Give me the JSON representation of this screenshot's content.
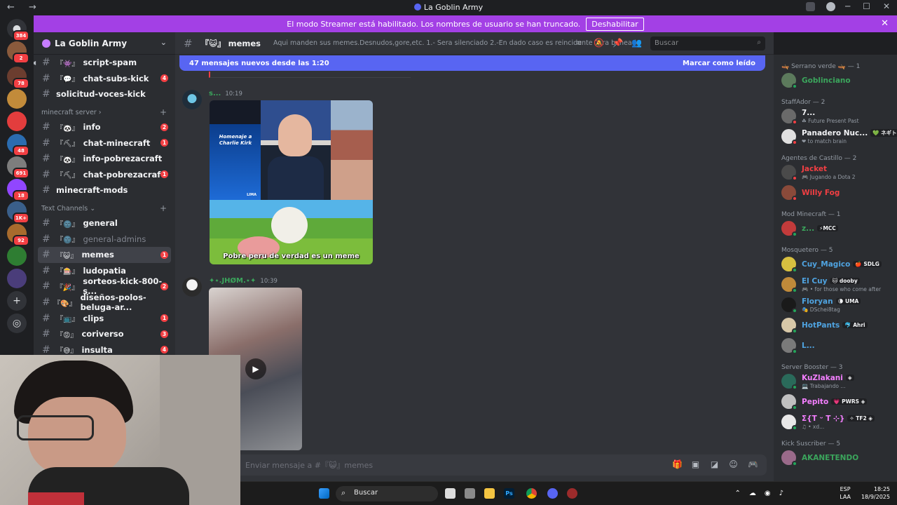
{
  "window": {
    "title": "La Goblin Army",
    "nav": "← →"
  },
  "streamer_banner": {
    "text": "El modo Streamer está habilitado. Los nombres de usuario se han truncado.",
    "button": "Deshabilitar",
    "close": "✕"
  },
  "server_badges": [
    "384",
    "2",
    "78",
    "691",
    "48",
    "691",
    "18",
    "1K+",
    "92"
  ],
  "guild": {
    "name": "La Goblin Army",
    "chevron": "⌄"
  },
  "channels": {
    "top": [
      {
        "emoji": "『👾』",
        "name": "script-spam",
        "badge": ""
      },
      {
        "emoji": "『💬』",
        "name": "chat-subs-kick",
        "badge": "4"
      },
      {
        "emoji": "",
        "name": "solicitud-voces-kick",
        "badge": ""
      }
    ],
    "cat_minecraft": "minecraft server",
    "minecraft": [
      {
        "emoji": "『🐼』",
        "name": "info",
        "badge": "2"
      },
      {
        "emoji": "『⛏』",
        "name": "chat-minecraft",
        "badge": "1"
      },
      {
        "emoji": "『🐼』",
        "name": "info-pobrezacraft",
        "badge": ""
      },
      {
        "emoji": "『⛏』",
        "name": "chat-pobrezacraft",
        "badge": "1"
      },
      {
        "emoji": "",
        "name": "minecraft-mods",
        "badge": ""
      }
    ],
    "cat_text": "Text Channels",
    "text": [
      {
        "emoji": "『🌚』",
        "name": "general",
        "badge": ""
      },
      {
        "emoji": "『🌚』",
        "name": "general-admins",
        "badge": ""
      },
      {
        "emoji": "『😺』",
        "name": "memes",
        "badge": "1"
      },
      {
        "emoji": "『🎰』",
        "name": "ludopatia",
        "badge": ""
      },
      {
        "emoji": "『🎉』",
        "name": "sorteos-kick-800-s...",
        "badge": "2"
      },
      {
        "emoji": "『🎨』",
        "name": "diseños-polos-beluga-ar...",
        "badge": ""
      },
      {
        "emoji": "『📺』",
        "name": "clips",
        "badge": "1"
      },
      {
        "emoji": "『😡』",
        "name": "coriverso",
        "badge": "3"
      },
      {
        "emoji": "『😅』",
        "name": "insulta",
        "badge": "4"
      }
    ]
  },
  "channel_header": {
    "name": "memes",
    "emoji": "『😺』",
    "topic": "Aqui manden sus memes.Desnudos,gore,etc. 1.- Sera silenciado 2.-En dado caso es reincidente sera baneado",
    "search_placeholder": "Buscar"
  },
  "new_messages": {
    "text": "47 mensajes nuevos desde las 1:20",
    "mark": "Marcar como leído"
  },
  "messages": [
    {
      "author": "s...",
      "time": "10:19",
      "author_color": "#3ba55c",
      "caption": "Pobre peru de verdad es un meme",
      "poster_title": "Homenaje a Charlie Kirk",
      "poster_brand": "LIMA"
    },
    {
      "author": "✦⋆.JHØM.⋆✦",
      "time": "10:39",
      "author_color": "#3ba55c"
    }
  ],
  "composer": {
    "placeholder": "Enviar mensaje a #『😺』memes"
  },
  "members": [
    {
      "category": "🛶 Serrano verde 🛶 — 1",
      "items": [
        {
          "name": "Goblinciano",
          "color": "#3ba55c",
          "sub": "",
          "tag": ""
        }
      ]
    },
    {
      "category": "StaffAdor — 2",
      "items": [
        {
          "name": "7...",
          "color": "#f2f3f5",
          "sub": "☘ Future Present Past",
          "tag": ""
        },
        {
          "name": "Panadero Nuc...",
          "color": "#f2f3f5",
          "sub": "❤ to match brain",
          "tag": "💚 ネギトロ"
        }
      ]
    },
    {
      "category": "Agentes de Castillo — 2",
      "items": [
        {
          "name": "Jacket",
          "color": "#f23f43",
          "sub": "🎮 Jugando a Dota 2",
          "tag": ""
        },
        {
          "name": "Willy Fog",
          "color": "#f23f43",
          "sub": "",
          "tag": ""
        }
      ]
    },
    {
      "category": "Mod Minecraft — 1",
      "items": [
        {
          "name": "z...",
          "color": "#3ba55c",
          "sub": "",
          "tag": "⚡MCC"
        }
      ]
    },
    {
      "category": "Mosquetero — 5",
      "items": [
        {
          "name": "Cuy_Magico",
          "color": "#4fa3e0",
          "sub": "",
          "tag": "🍎 SDLG"
        },
        {
          "name": "El Cuy",
          "color": "#4fa3e0",
          "sub": "🎮 • for those who come after",
          "tag": "🐱 dooby"
        },
        {
          "name": "Floryan",
          "color": "#4fa3e0",
          "sub": "🎭 DSchei8tag",
          "tag": "🌘 UMA"
        },
        {
          "name": "HotPants",
          "color": "#4fa3e0",
          "sub": "",
          "tag": "🐬 Ahri"
        },
        {
          "name": "L...",
          "color": "#4fa3e0",
          "sub": "",
          "tag": ""
        }
      ]
    },
    {
      "category": "Server Booster — 3",
      "items": [
        {
          "name": "KuZlakani",
          "color": "#f47fff",
          "sub": "💻 Trabajando ...",
          "tag": "◈"
        },
        {
          "name": "Pepito",
          "color": "#f47fff",
          "sub": "",
          "tag": "💗 PWRS ◈"
        },
        {
          "name": "Σ{T ᵕ T ⊹}",
          "color": "#f47fff",
          "sub": "♫ • xd...",
          "tag": "✧ TF2 ◈"
        }
      ]
    },
    {
      "category": "Kick Suscriber — 5",
      "items": [
        {
          "name": "AKANETENDO",
          "color": "#3ba55c",
          "sub": "",
          "tag": ""
        }
      ]
    }
  ],
  "taskbar": {
    "search": "Buscar",
    "lang": "ESP",
    "lang2": "LAA",
    "time": "18:25",
    "date": "18/9/2025"
  }
}
